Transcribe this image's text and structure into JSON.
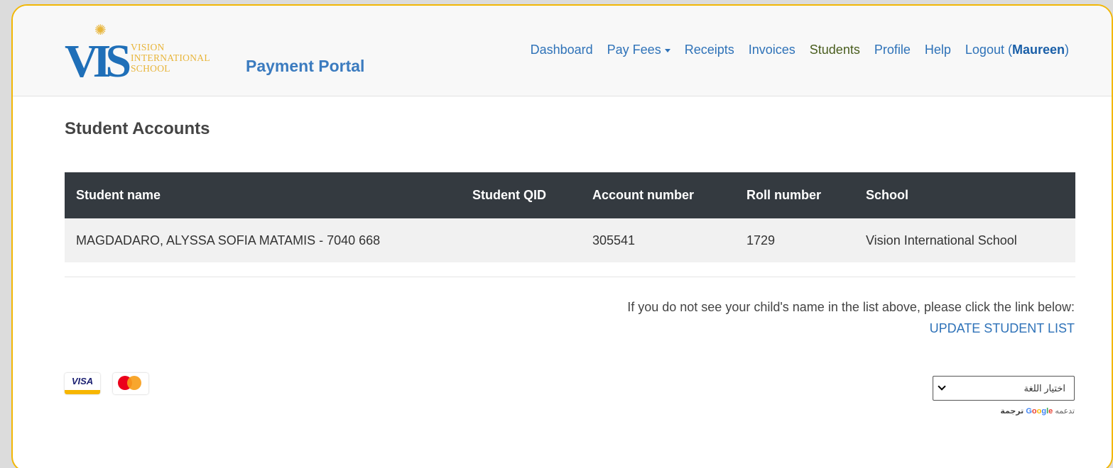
{
  "header": {
    "logo": {
      "initials": "VIS",
      "lines": [
        "VISION",
        "INTERNATIONAL",
        "SCHOOL"
      ]
    },
    "brand": "Payment Portal",
    "nav": {
      "dashboard": "Dashboard",
      "pay_fees": "Pay Fees",
      "receipts": "Receipts",
      "invoices": "Invoices",
      "students": "Students",
      "profile": "Profile",
      "help": "Help",
      "logout": "Logout",
      "user": "Maureen"
    }
  },
  "main": {
    "title": "Student Accounts",
    "table": {
      "headers": [
        "Student name",
        "Student QID",
        "Account number",
        "Roll number",
        "School"
      ],
      "rows": [
        [
          "MAGDADARO, ALYSSA SOFIA MATAMIS - 7040 668",
          "",
          "305541",
          "1729",
          "Vision International School"
        ]
      ]
    },
    "notice": "If you do not see your child's name in the list above, please click the link below:",
    "update_link": "UPDATE STUDENT LIST"
  },
  "footer": {
    "cards": {
      "visa": "VISA"
    },
    "language": {
      "selected": "اختيار اللغة",
      "powered_prefix": "تدعمه",
      "google": [
        "G",
        "o",
        "o",
        "g",
        "l",
        "e"
      ],
      "translate": "ترجمة"
    }
  },
  "colors": {
    "frame_border": "#f2b705",
    "link": "#2e72b8",
    "table_header": "#343a40",
    "active_nav": "#4a5e1f"
  }
}
